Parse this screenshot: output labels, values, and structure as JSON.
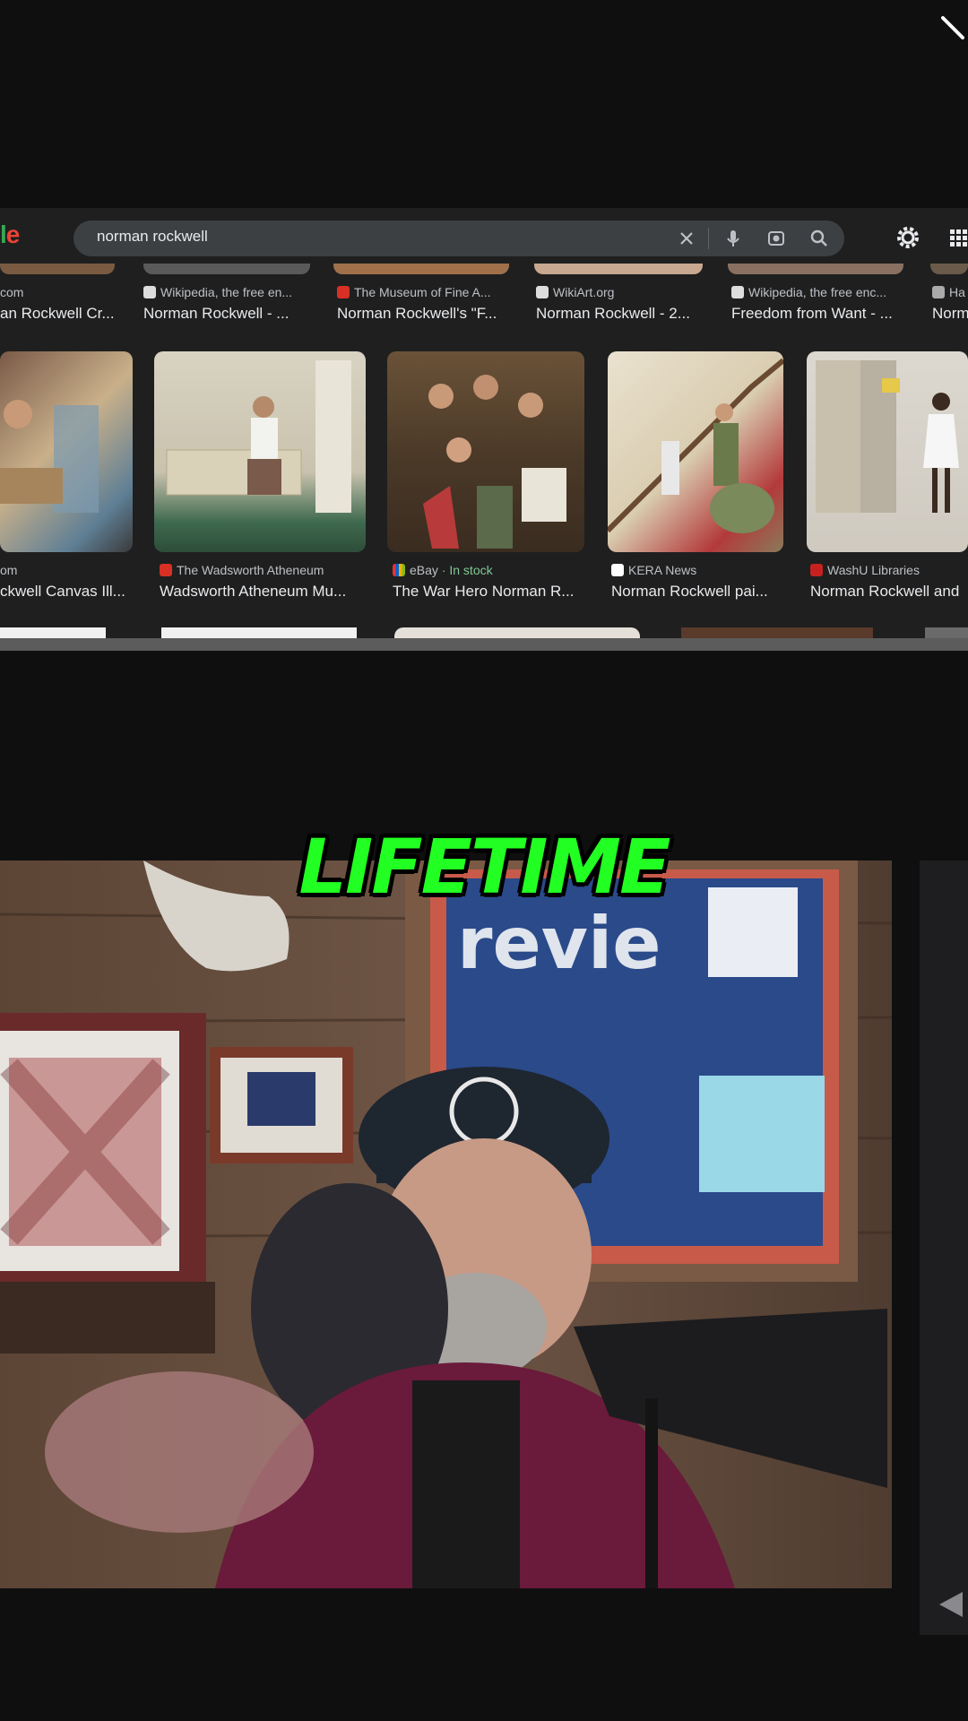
{
  "search": {
    "query": "norman rockwell",
    "logo_fragment_l": "l",
    "logo_fragment_e": "e"
  },
  "row1": [
    {
      "source": "com",
      "title": "an Rockwell Cr...",
      "fav_color": "#888888"
    },
    {
      "source": "Wikipedia, the free en...",
      "title": "Norman Rockwell - ...",
      "fav_color": "#dddddd"
    },
    {
      "source": "The Museum of Fine A...",
      "title": "Norman Rockwell's \"F...",
      "fav_color": "#d93025"
    },
    {
      "source": "WikiArt.org",
      "title": "Norman Rockwell - 2...",
      "fav_color": "#dddddd"
    },
    {
      "source": "Wikipedia, the free enc...",
      "title": "Freedom from Want - ...",
      "fav_color": "#dddddd"
    },
    {
      "source": "Ha",
      "title": "Norm",
      "fav_color": "#aaaaaa"
    }
  ],
  "row2": [
    {
      "source": "om",
      "title": "ckwell Canvas Ill...",
      "fav_color": "#888888"
    },
    {
      "source": "The Wadsworth Atheneum",
      "title": "Wadsworth Atheneum Mu...",
      "fav_color": "#d93025"
    },
    {
      "source": "eBay",
      "stock": "· In stock",
      "title": "The War Hero Norman R...",
      "fav_color": "#4285f4"
    },
    {
      "source": "KERA News",
      "title": "Norman Rockwell pai...",
      "fav_color": "#ffffff"
    },
    {
      "source": "WashU Libraries",
      "title": "Norman Rockwell and",
      "fav_color": "#c5221f"
    }
  ],
  "caption": {
    "text": "LIFETIME"
  },
  "colors": {
    "caption": "#22ff22",
    "panel": "#1f1f1f",
    "search_bg": "#3c4043"
  }
}
